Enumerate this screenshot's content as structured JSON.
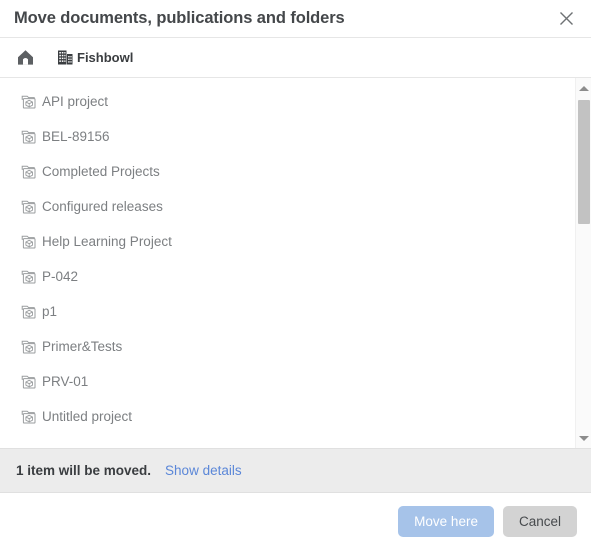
{
  "dialog": {
    "title": "Move documents, publications and folders",
    "close_icon": "close-icon"
  },
  "breadcrumb": {
    "home": {
      "icon": "home-icon",
      "label": ""
    },
    "current": {
      "icon": "building-icon",
      "label": "Fishbowl"
    }
  },
  "list": {
    "items": [
      {
        "icon": "folder-project-icon",
        "label": "API project"
      },
      {
        "icon": "folder-project-icon",
        "label": "BEL-89156"
      },
      {
        "icon": "folder-project-icon",
        "label": "Completed Projects"
      },
      {
        "icon": "folder-project-icon",
        "label": "Configured releases"
      },
      {
        "icon": "folder-project-icon",
        "label": "Help Learning Project"
      },
      {
        "icon": "folder-project-icon",
        "label": "P-042"
      },
      {
        "icon": "folder-project-icon",
        "label": "p1"
      },
      {
        "icon": "folder-project-icon",
        "label": "Primer&Tests"
      },
      {
        "icon": "folder-project-icon",
        "label": "PRV-01"
      },
      {
        "icon": "folder-project-icon",
        "label": "Untitled project"
      }
    ]
  },
  "scrollbar": {
    "up_icon": "chevron-up-icon",
    "down_icon": "chevron-down-icon"
  },
  "status": {
    "message": "1 item will be moved.",
    "details_link": "Show details"
  },
  "footer": {
    "primary_label": "Move here",
    "secondary_label": "Cancel"
  },
  "colors": {
    "primary_button_bg": "#a6c3e9",
    "secondary_button_bg": "#d3d3d3",
    "link": "#5b87d8",
    "status_bar_bg": "#ececec",
    "item_text": "#7c7f82",
    "title_text": "#44474a"
  }
}
